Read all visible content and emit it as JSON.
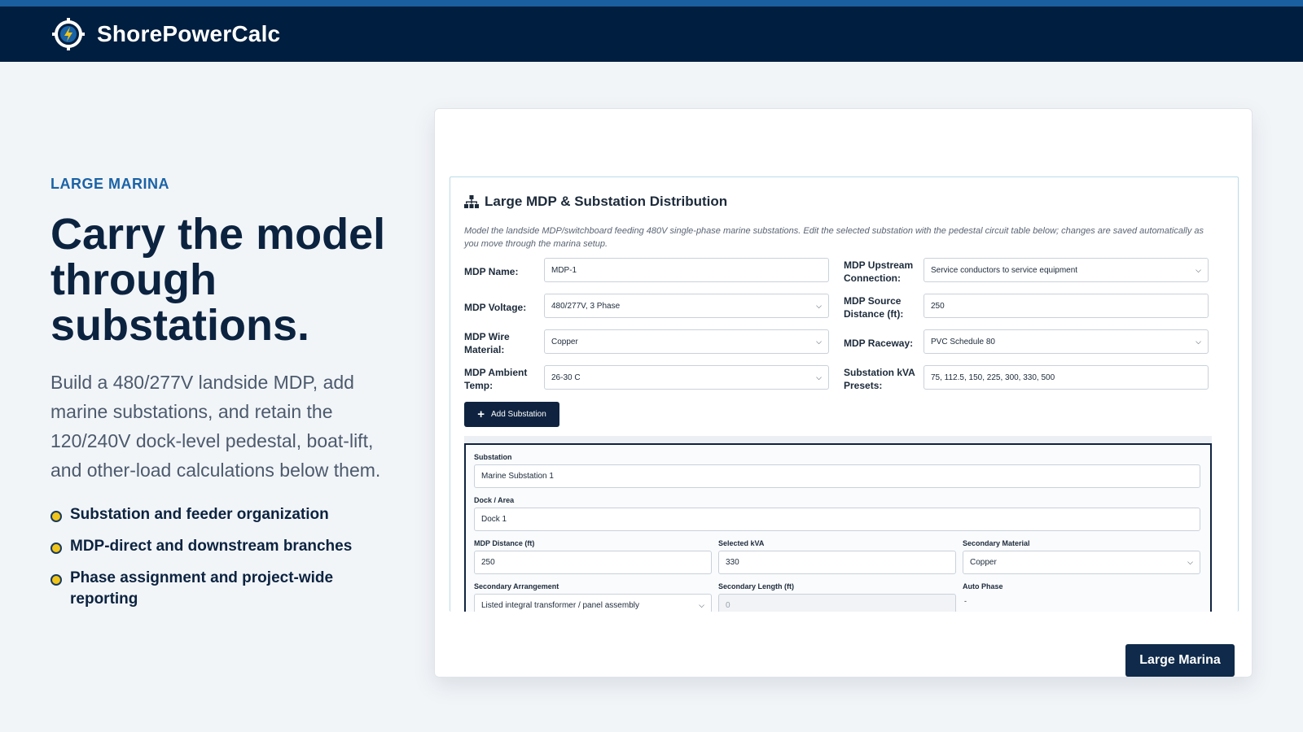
{
  "header": {
    "brand": "ShorePowerCalc",
    "logo_icon": "lightning-bolt-gear-icon"
  },
  "hero": {
    "eyebrow": "LARGE MARINA",
    "headline": "Carry the model through substations.",
    "lede": "Build a 480/277V landside MDP, add marine substations, and retain the 120/240V dock-level pedestal, boat-lift, and other-load calculations below them.",
    "features": [
      "Substation and feeder organization",
      "MDP-direct and downstream branches",
      "Phase assignment and project-wide reporting"
    ]
  },
  "panel": {
    "icon": "sitemap-icon",
    "title": "Large MDP & Substation Distribution",
    "description": "Model the landside MDP/switchboard feeding 480V single-phase marine substations. Edit the selected substation with the pedestal circuit table below; changes are saved automatically as you move through the marina setup.",
    "fields": {
      "mdp_name": {
        "label": "MDP Name:",
        "value": "MDP-1"
      },
      "mdp_upstream": {
        "label": "MDP Upstream Connection:",
        "value": "Service conductors to service equipment"
      },
      "mdp_voltage": {
        "label": "MDP Voltage:",
        "value": "480/277V, 3 Phase"
      },
      "mdp_source_distance": {
        "label": "MDP Source Distance (ft):",
        "value": "250"
      },
      "mdp_wire_material": {
        "label": "MDP Wire Material:",
        "value": "Copper"
      },
      "mdp_raceway": {
        "label": "MDP Raceway:",
        "value": "PVC Schedule 80"
      },
      "mdp_ambient_temp": {
        "label": "MDP Ambient Temp:",
        "value": "26-30 C"
      },
      "substation_kva_presets": {
        "label": "Substation kVA Presets:",
        "value": "75, 112.5, 150, 225, 300, 330, 500"
      }
    },
    "add_button": "Add Substation",
    "substation": {
      "name_label": "Substation",
      "name_value": "Marine Substation 1",
      "dock_label": "Dock / Area",
      "dock_value": "Dock 1",
      "mdp_distance_label": "MDP Distance (ft)",
      "mdp_distance_value": "250",
      "selected_kva_label": "Selected kVA",
      "selected_kva_value": "330",
      "secondary_material_label": "Secondary Material",
      "secondary_material_value": "Copper",
      "secondary_arrangement_label": "Secondary Arrangement",
      "secondary_arrangement_value": "Listed integral transformer / panel assembly",
      "secondary_length_label": "Secondary Length (ft)",
      "secondary_length_value": "0",
      "auto_phase_label": "Auto Phase",
      "auto_phase_value": "-"
    }
  },
  "cta": {
    "label": "Large Marina"
  },
  "colors": {
    "navy": "#001e3f",
    "accent_blue": "#1a63a6",
    "bullet_yellow": "#f0c419"
  }
}
